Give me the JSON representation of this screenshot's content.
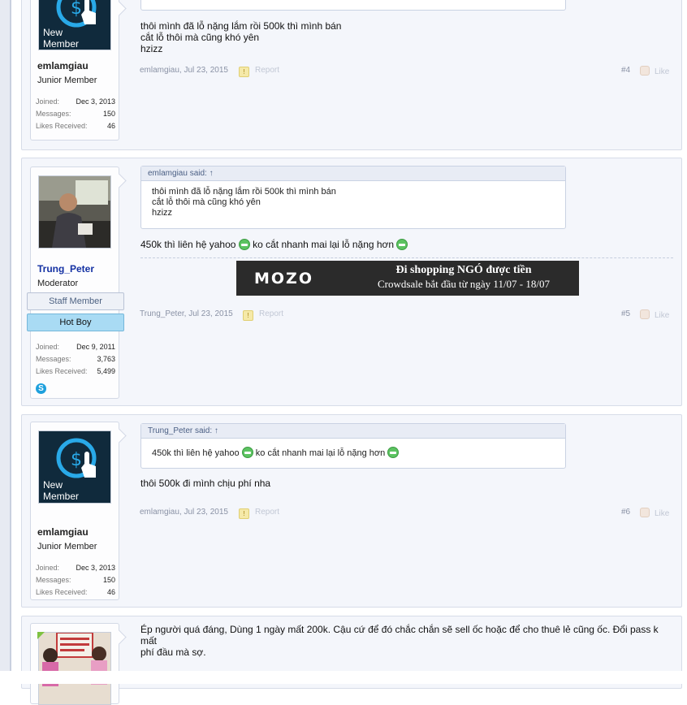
{
  "posts": [
    {
      "author": "emlamgiau",
      "role": "Junior Member",
      "avatar_caption": [
        "New",
        "Member"
      ],
      "stats": {
        "joined_label": "Joined:",
        "joined": "Dec 3, 2013",
        "messages_label": "Messages:",
        "messages": "150",
        "likes_label": "Likes Received:",
        "likes": "46"
      },
      "message": [
        "thôi mình đã lỗ nặng lắm rồi 500k thì mình bán",
        "cắt lỗ thôi mà cũng khó yên",
        "hzizz"
      ],
      "meta": "emlamgiau, Jul 23, 2015",
      "report": "Report",
      "number": "#4",
      "like": "Like"
    },
    {
      "author": "Trung_Peter",
      "role": "Moderator",
      "banners": [
        "Staff Member",
        "Hot Boy"
      ],
      "stats": {
        "joined_label": "Joined:",
        "joined": "Dec 9, 2011",
        "messages_label": "Messages:",
        "messages": "3,763",
        "likes_label": "Likes Received:",
        "likes": "5,499"
      },
      "quote_head": "emlamgiau said: ↑",
      "quote": [
        "thôi mình đã lỗ nặng lắm rồi 500k thì mình bán",
        "cắt lỗ thôi mà cũng khó yên",
        "hzizz"
      ],
      "message_a": "450k thì liên hệ yahoo",
      "message_b": "ko cắt nhanh mai lại lỗ nặng hơn",
      "ad": {
        "logo": "MOZO",
        "line1": "Đi shopping NGÓ được tiền",
        "line2": "Crowdsale bắt đầu từ ngày 11/07 - 18/07"
      },
      "meta": "Trung_Peter, Jul 23, 2015",
      "report": "Report",
      "number": "#5",
      "like": "Like"
    },
    {
      "author": "emlamgiau",
      "role": "Junior Member",
      "avatar_caption": [
        "New",
        "Member"
      ],
      "stats": {
        "joined_label": "Joined:",
        "joined": "Dec 3, 2013",
        "messages_label": "Messages:",
        "messages": "150",
        "likes_label": "Likes Received:",
        "likes": "46"
      },
      "quote_head": "Trung_Peter said: ↑",
      "quote_a": "450k thì liên hệ yahoo",
      "quote_b": "ko cắt nhanh mai lại lỗ nặng hơn",
      "message": "thôi 500k đi mình chịu phí nha",
      "meta": "emlamgiau, Jul 23, 2015",
      "report": "Report",
      "number": "#6",
      "like": "Like"
    },
    {
      "message": [
        "Ép người quá đáng, Dùng 1 ngày mất 200k. Cậu cứ để đó chắc chắn sẽ sell ốc hoặc để cho thuê lẻ cũng ốc. Đổi pass k mất",
        "phí đầu mà sợ."
      ]
    }
  ]
}
